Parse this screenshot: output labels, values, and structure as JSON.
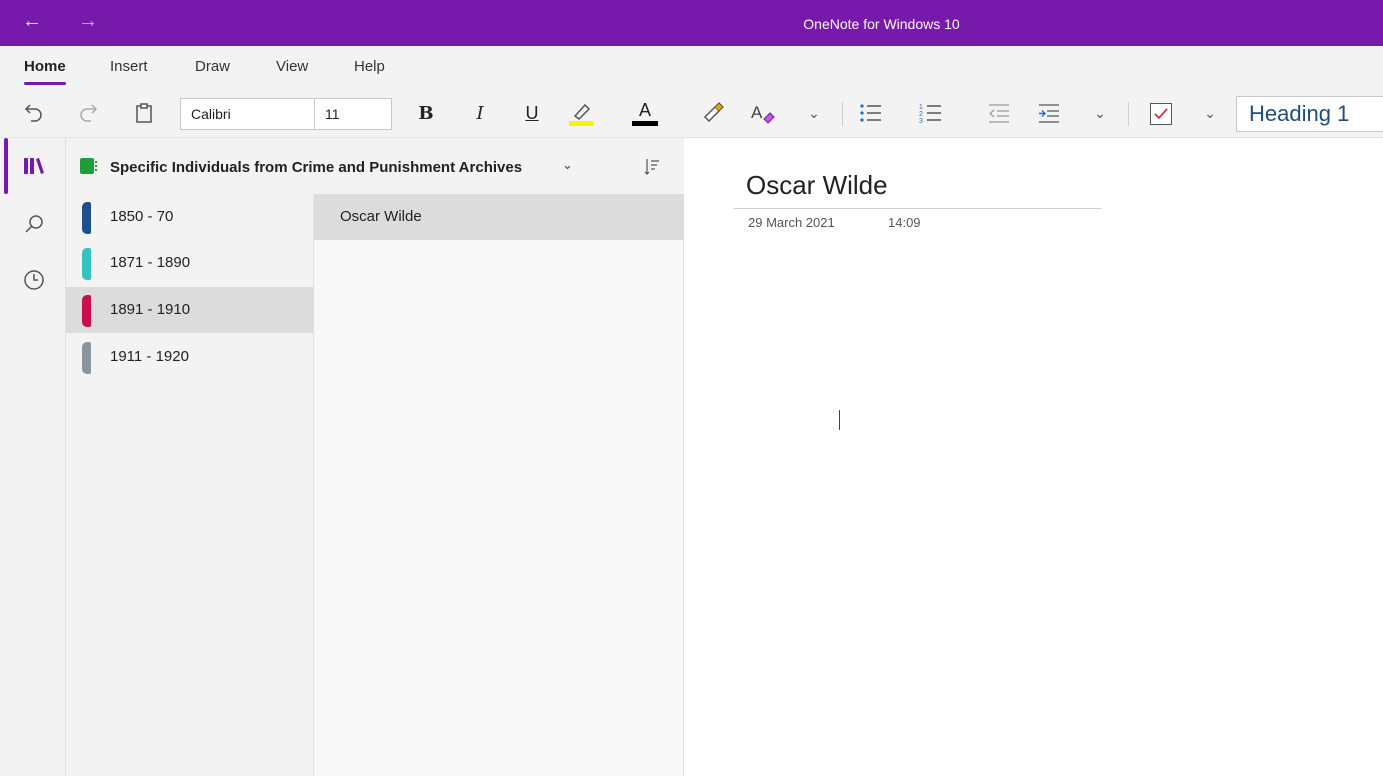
{
  "app": {
    "title": "OneNote for Windows 10",
    "accent": "#7719aa"
  },
  "titlebar": {
    "back_icon": "arrow-left-icon",
    "forward_icon": "arrow-right-icon"
  },
  "ribbon": {
    "tabs": [
      {
        "label": "Home",
        "active": true
      },
      {
        "label": "Insert",
        "active": false
      },
      {
        "label": "Draw",
        "active": false
      },
      {
        "label": "View",
        "active": false
      },
      {
        "label": "Help",
        "active": false
      }
    ],
    "font_name": "Calibri",
    "font_size": "11",
    "bold": "B",
    "italic": "I",
    "underline": "U",
    "font_color_glyph": "A",
    "style": "Heading 1",
    "highlight_color": "#f5f500",
    "font_color": "#000000"
  },
  "notebook": {
    "title": "Specific Individuals from Crime and Punishment Archives",
    "color": "#1e9e3b",
    "sections": [
      {
        "label": "1850 - 70",
        "color": "#1f4e8c",
        "selected": false
      },
      {
        "label": "1871 - 1890",
        "color": "#33c2c0",
        "selected": false
      },
      {
        "label": "1891 - 1910",
        "color": "#c8104f",
        "selected": true
      },
      {
        "label": "1911 - 1920",
        "color": "#8a969c",
        "selected": false
      }
    ],
    "pages": [
      {
        "label": "Oscar Wilde",
        "selected": true
      }
    ]
  },
  "page": {
    "title": "Oscar Wilde",
    "date": "29 March 2021",
    "time": "14:09"
  }
}
